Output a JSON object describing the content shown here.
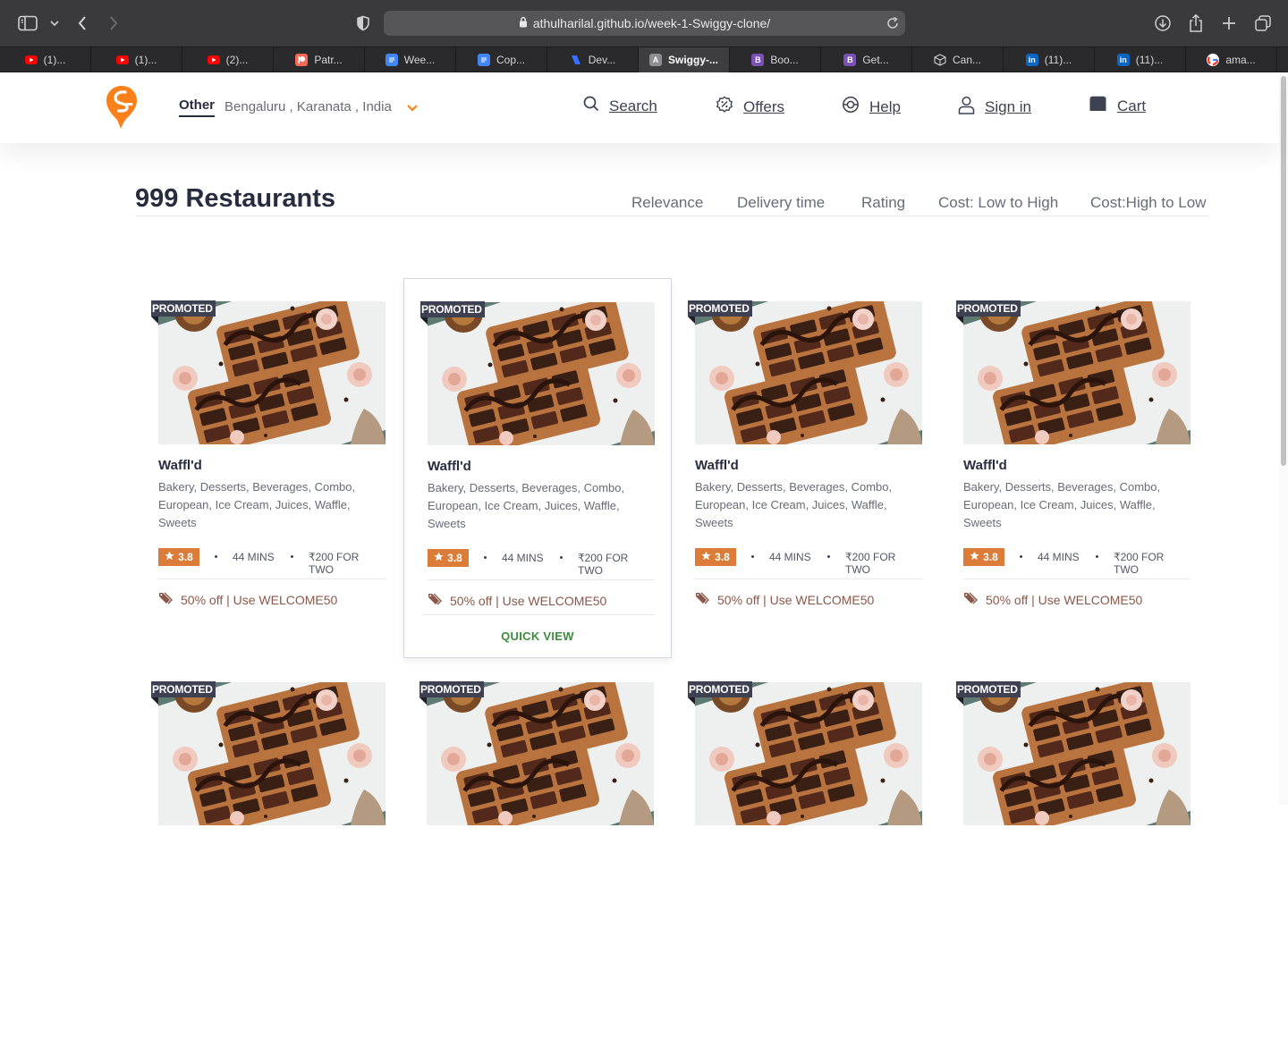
{
  "browser": {
    "url": "athulharilal.github.io/week-1-Swiggy-clone/",
    "tabs": [
      {
        "label": "(1)...",
        "icon": "youtube-icon"
      },
      {
        "label": "(1)...",
        "icon": "youtube-icon"
      },
      {
        "label": "(2)...",
        "icon": "youtube-icon"
      },
      {
        "label": "Patr...",
        "icon": "patreon-icon"
      },
      {
        "label": "Wee...",
        "icon": "google-docs-icon"
      },
      {
        "label": "Cop...",
        "icon": "google-docs-icon"
      },
      {
        "label": "Dev...",
        "icon": "devfolio-icon"
      },
      {
        "label": "Swiggy-...",
        "icon": "site-letter-icon",
        "letter": "A",
        "active": true
      },
      {
        "label": "Boo...",
        "icon": "bootstrap-icon",
        "letter": "B"
      },
      {
        "label": "Get...",
        "icon": "bootstrap-icon",
        "letter": "B"
      },
      {
        "label": "Can...",
        "icon": "cube-icon"
      },
      {
        "label": "(11)...",
        "icon": "linkedin-icon",
        "letter": "in"
      },
      {
        "label": "(11)...",
        "icon": "linkedin-icon",
        "letter": "in"
      },
      {
        "label": "ama...",
        "icon": "google-icon",
        "letter": "G"
      }
    ]
  },
  "header": {
    "location_type": "Other",
    "location_address": "Bengaluru , Karanata , India",
    "nav": {
      "search": "Search",
      "offers": "Offers",
      "help": "Help",
      "signin": "Sign in",
      "cart": "Cart"
    },
    "accent_color": "#fc8019"
  },
  "listing": {
    "count_label": "999 Restaurants",
    "sorts": [
      "Relevance",
      "Delivery time",
      "Rating",
      "Cost: Low to High",
      "Cost:High to Low"
    ]
  },
  "cards": [
    {
      "promoted": "PROMOTED",
      "name": "Waffl'd",
      "cuisines": "Bakery, Desserts, Beverages, Combo, European, Ice Cream, Juices, Waffle, Sweets",
      "rating": "3.8",
      "time": "44 MINS",
      "cost": "₹200 FOR TWO",
      "offer": "50% off | Use WELCOME50"
    },
    {
      "promoted": "PROMOTED",
      "name": "Waffl'd",
      "cuisines": "Bakery, Desserts, Beverages, Combo, European, Ice Cream, Juices, Waffle, Sweets",
      "rating": "3.8",
      "time": "44 MINS",
      "cost": "₹200 FOR TWO",
      "offer": "50% off | Use WELCOME50",
      "quick_view": "QUICK VIEW"
    },
    {
      "promoted": "PROMOTED",
      "name": "Waffl'd",
      "cuisines": "Bakery, Desserts, Beverages, Combo, European, Ice Cream, Juices, Waffle, Sweets",
      "rating": "3.8",
      "time": "44 MINS",
      "cost": "₹200 FOR TWO",
      "offer": "50% off | Use WELCOME50"
    },
    {
      "promoted": "PROMOTED",
      "name": "Waffl'd",
      "cuisines": "Bakery, Desserts, Beverages, Combo, European, Ice Cream, Juices, Waffle, Sweets",
      "rating": "3.8",
      "time": "44 MINS",
      "cost": "₹200 FOR TWO",
      "offer": "50% off | Use WELCOME50"
    },
    {
      "promoted": "PROMOTED"
    },
    {
      "promoted": "PROMOTED"
    },
    {
      "promoted": "PROMOTED"
    },
    {
      "promoted": "PROMOTED"
    }
  ]
}
